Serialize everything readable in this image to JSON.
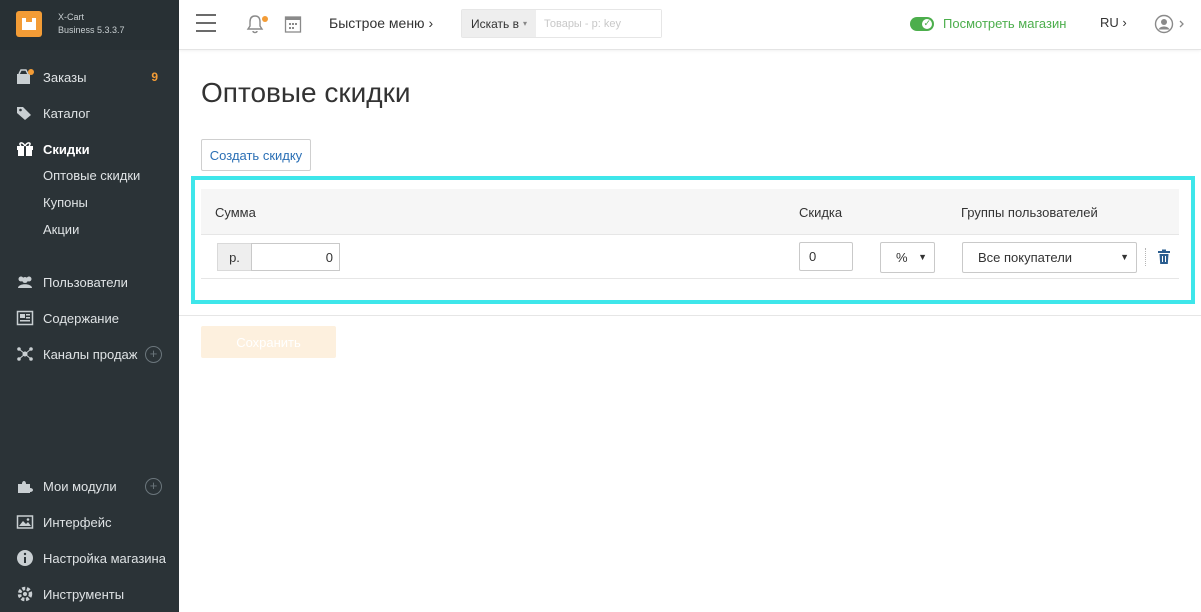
{
  "app": {
    "name": "X-Cart",
    "version": "Business 5.3.3.7"
  },
  "sidebar": {
    "items": [
      {
        "label": "Заказы",
        "count": "9"
      },
      {
        "label": "Каталог"
      },
      {
        "label": "Скидки"
      },
      {
        "label": "Пользователи"
      },
      {
        "label": "Содержание"
      },
      {
        "label": "Каналы продаж"
      },
      {
        "label": "Мои модули"
      },
      {
        "label": "Интерфейс"
      },
      {
        "label": "Настройка магазина"
      },
      {
        "label": "Инструменты"
      }
    ],
    "sub_items": [
      {
        "label": "Оптовые скидки"
      },
      {
        "label": "Купоны"
      },
      {
        "label": "Акции"
      }
    ]
  },
  "header": {
    "quick_menu": "Быстрое меню",
    "search_in_label": "Искать в",
    "search_placeholder": "Товары - p: key",
    "view_store": "Посмотреть магазин",
    "language": "RU"
  },
  "page": {
    "title": "Оптовые скидки",
    "create_button": "Создать скидку",
    "save_button": "Сохранить"
  },
  "table": {
    "columns": [
      "Сумма",
      "Скидка",
      "Группы пользователей"
    ],
    "row": {
      "currency": "р.",
      "amount": "0",
      "discount": "0",
      "type": "%",
      "group": "Все покупатели"
    }
  },
  "colors": {
    "accent": "#f39c36",
    "sidebar_bg": "#2b3337",
    "store_link": "#4cae4c",
    "highlight": "#3ee6ea"
  }
}
